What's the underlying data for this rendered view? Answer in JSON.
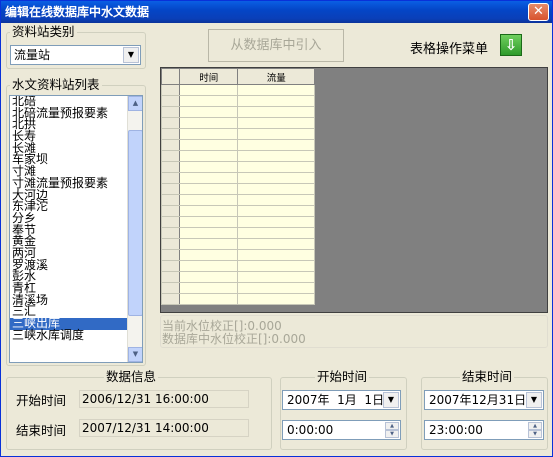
{
  "window": {
    "title": "编辑在线数据库中水文数据",
    "close_glyph": "✕"
  },
  "station_type": {
    "group_label": "资料站类别",
    "selected": "流量站"
  },
  "station_list": {
    "group_label": "水文资料站列表",
    "items": [
      "北碚",
      "北碚流量预报要素",
      "北拱",
      "长寿",
      "长滩",
      "车家坝",
      "寸滩",
      "寸滩流量预报要素",
      "大河边",
      "东津沱",
      "分乡",
      "奉节",
      "黄金",
      "两河",
      "罗渡溪",
      "彭水",
      "青杠",
      "清溪场",
      "三汇",
      "三峡出库",
      "三峡水库调度"
    ],
    "selected_index": 19
  },
  "toolbar": {
    "import_label": "从数据库中引入",
    "menu_label": "表格操作菜单",
    "menu_icon": "down-arrow"
  },
  "grid": {
    "columns": [
      "时间",
      "流量"
    ],
    "row_count": 20
  },
  "status": {
    "line1": "当前水位校正[]:0.000",
    "line2": "数据库中水位校正[]:0.000"
  },
  "data_info": {
    "group_label": "数据信息",
    "start_label": "开始时间",
    "start_value": "2006/12/31 16:00:00",
    "end_label": "结束时间",
    "end_value": "2007/12/31 14:00:00"
  },
  "start_time": {
    "group_label": "开始时间",
    "date": "2007年  1月  1日",
    "time": "0:00:00"
  },
  "end_time": {
    "group_label": "结束时间",
    "date": "2007年12月31日",
    "time": "23:00:00"
  }
}
